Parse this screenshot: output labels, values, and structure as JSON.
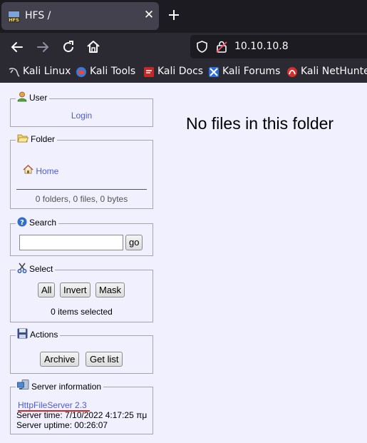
{
  "browser": {
    "tab_title": "HFS /",
    "url": "10.10.10.8",
    "bookmarks": [
      "Kali Linux",
      "Kali Tools",
      "Kali Docs",
      "Kali Forums",
      "Kali NetHunter"
    ]
  },
  "panels": {
    "user": {
      "title": "User",
      "login": "Login"
    },
    "folder": {
      "title": "Folder",
      "home": "Home",
      "summary": "0 folders, 0 files, 0 bytes"
    },
    "search": {
      "title": "Search",
      "value": "",
      "go": "go"
    },
    "select": {
      "title": "Select",
      "all": "All",
      "invert": "Invert",
      "mask": "Mask",
      "status": "0 items selected"
    },
    "actions": {
      "title": "Actions",
      "archive": "Archive",
      "get_list": "Get list"
    },
    "server": {
      "title": "Server information",
      "link": "HttpFileServer 2.3",
      "time": "Server time: 7/10/2022 4:17:25 πμ",
      "uptime": "Server uptime: 00:26:07"
    }
  },
  "main": {
    "message": "No files in this folder"
  }
}
